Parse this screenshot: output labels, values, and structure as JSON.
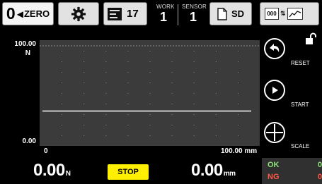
{
  "toolbar": {
    "zero": {
      "big": "0",
      "arrow": "◀",
      "label": "ZERO"
    },
    "gear_icon": "gear-icon",
    "count": {
      "value": "17"
    },
    "work": {
      "label": "WORK",
      "value": "1"
    },
    "sensor": {
      "label": "SENSOR",
      "value": "1"
    },
    "sd": {
      "label": "SD"
    },
    "trend": {
      "box_text": "000",
      "arrows": "⇅"
    }
  },
  "graph": {
    "y_max_value": "100.00",
    "y_unit": "N",
    "y_min_value": "0.00",
    "x_min_value": "0",
    "x_max_value": "100.00 mm",
    "trace_level": 0.33,
    "limit_line_level": 1.0,
    "colors": {
      "plot_bg": "#3b3b3b",
      "grid": "#8a8a8a",
      "trace": "#ffffff"
    }
  },
  "side_buttons": {
    "reset": "RESET",
    "start": "START",
    "scale": "SCALE"
  },
  "bottom": {
    "force_value": "0.00",
    "force_unit": "N",
    "stop_label": "STOP",
    "distance_value": "0.00",
    "distance_unit": "mm",
    "judge": {
      "ok_label": "OK",
      "ok_count": "0",
      "ng_label": "NG",
      "ng_count": "0",
      "ok_color": "#8ee07a",
      "ng_color": "#ff5a44"
    }
  }
}
